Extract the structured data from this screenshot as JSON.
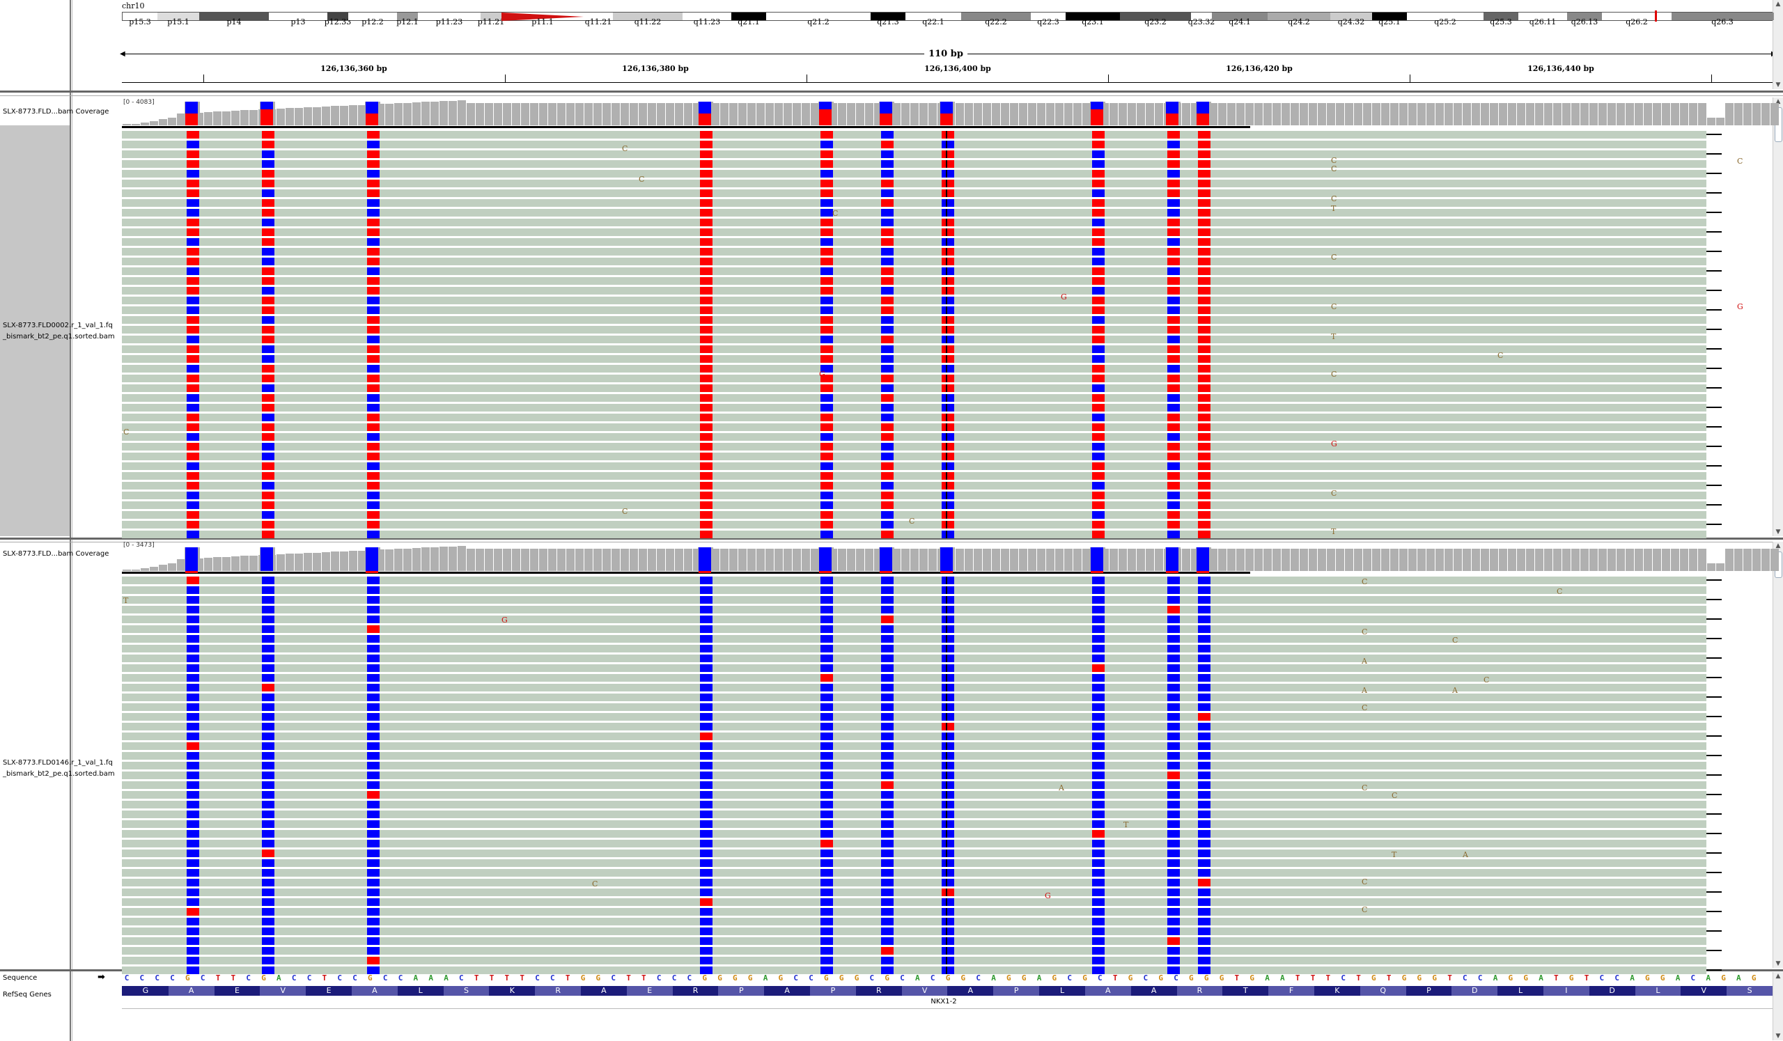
{
  "chromosome": {
    "name": "chr10",
    "bands": [
      "p15.3",
      "p15.1",
      "p14",
      "p13",
      "p12.33",
      "p12.2",
      "p12.1",
      "p11.23",
      "p11.21",
      "p11.1",
      "q11.21",
      "q11.22",
      "q11.23",
      "q21.1",
      "q21.2",
      "q21.3",
      "q22.1",
      "q22.2",
      "q22.3",
      "q23.1",
      "q23.2",
      "q23.32",
      "q24.1",
      "q24.2",
      "q24.32",
      "q25.1",
      "q25.2",
      "q25.3",
      "q26.11",
      "q26.13",
      "q26.2",
      "q26.3"
    ]
  },
  "ruler": {
    "span_label": "110 bp",
    "ticks": [
      "126,136,360 bp",
      "126,136,380 bp",
      "126,136,400 bp",
      "126,136,420 bp",
      "126,136,440 bp"
    ]
  },
  "tracks": [
    {
      "coverage_name": "SLX-8773.FLD...bam Coverage",
      "coverage_range": "[0 - 4083]",
      "alignment_name_line1": "SLX-8773.FLD0002.r_1_val_1.fq",
      "alignment_name_line2": "_bismark_bt2_pe.q1.sorted.bam"
    },
    {
      "coverage_name": "SLX-8773.FLD...bam Coverage",
      "coverage_range": "[0 - 3473]",
      "alignment_name_line1": "SLX-8773.FLD0146.r_1_val_1.fq",
      "alignment_name_line2": "_bismark_bt2_pe.q1.sorted.bam"
    }
  ],
  "sequence_label": "Sequence",
  "refseq_label": "RefSeq Genes",
  "sequence": "CCCCGCTTCGACCTCCGCCAAACTTTTCCTGGCTTCCCGGGGAGCCGGGCGCACGGCAGGAGCGCTGCGCGGGTGAATTTCTGTGGGTCCAGGATGTCCAGGACAGAG",
  "amino_acids": [
    "G",
    "A",
    "E",
    "V",
    "E",
    "A",
    "L",
    "S",
    "K",
    "R",
    "A",
    "E",
    "R",
    "P",
    "A",
    "P",
    "R",
    "V",
    "A",
    "P",
    "L",
    "A",
    "A",
    "R",
    "T",
    "F",
    "K",
    "Q",
    "P",
    "D",
    "L",
    "I",
    "D",
    "L",
    "V",
    "S"
  ],
  "gene_name": "NKX1-2",
  "base_colors": {
    "A": "#2e9a2e",
    "C": "#1f2fd0",
    "G": "#d08a10",
    "T": "#d01010"
  },
  "cpg_methylated_color": "#ff0000",
  "cpg_unmethylated_color": "#0000ff",
  "read_color": "#c0cfc0",
  "coverage_color": "#a8a8a8",
  "mismatch_letters": {
    "track1": [
      "C",
      "C",
      "C",
      "C",
      "T",
      "C",
      "G",
      "C",
      "G",
      "T",
      "C",
      "C",
      "C",
      "G",
      "C",
      "C",
      "C",
      "T",
      "C",
      "G",
      "C",
      "C"
    ],
    "track2": [
      "T",
      "G",
      "C",
      "C",
      "C",
      "C",
      "A",
      "C",
      "A",
      "C",
      "T",
      "C",
      "A",
      "A",
      "G",
      "C",
      "C",
      "A",
      "C",
      "T",
      "C"
    ]
  }
}
